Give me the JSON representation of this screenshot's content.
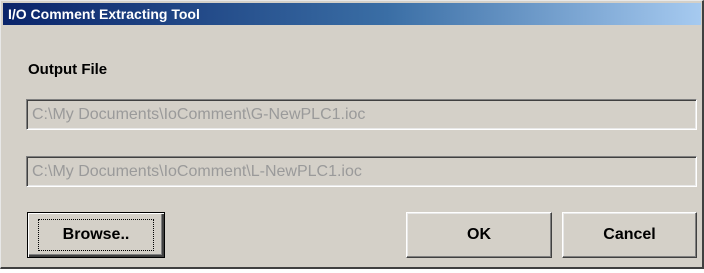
{
  "window": {
    "title": "I/O Comment Extracting Tool"
  },
  "output": {
    "label": "Output File",
    "files": [
      "C:\\My Documents\\IoComment\\G-NewPLC1.ioc",
      "C:\\My Documents\\IoComment\\L-NewPLC1.ioc"
    ]
  },
  "buttons": {
    "browse": "Browse..",
    "ok": "OK",
    "cancel": "Cancel"
  },
  "colors": {
    "face": "#d4d0c8",
    "title_start": "#0a246a",
    "title_end": "#a6caf0",
    "disabled_text": "#9a9a9a"
  }
}
